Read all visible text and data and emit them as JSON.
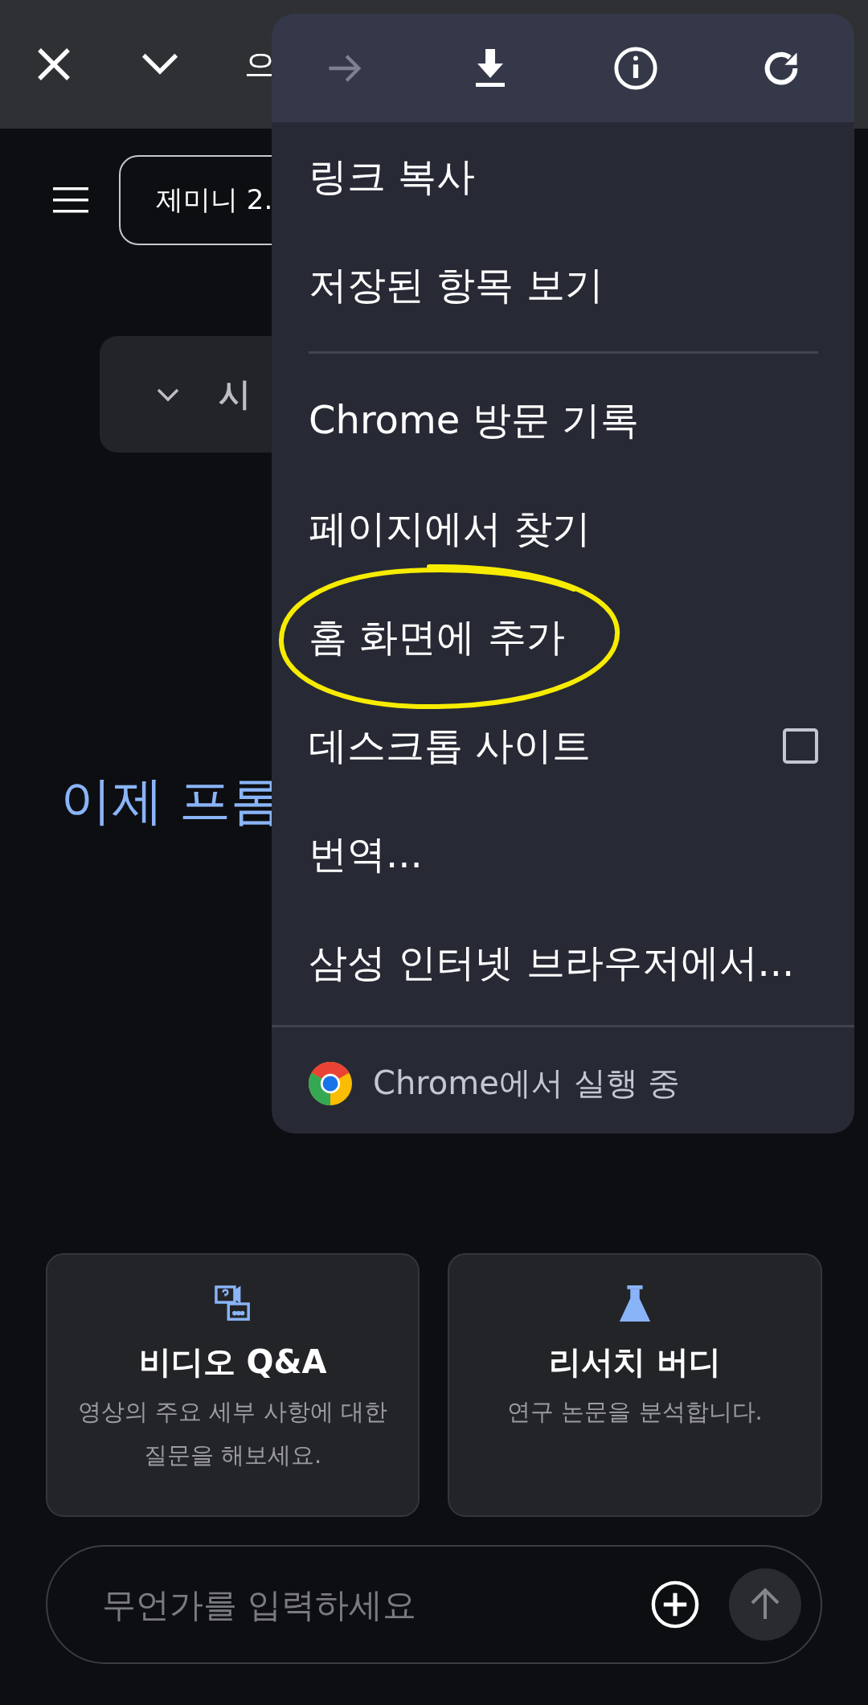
{
  "top_bar": {
    "title": "으"
  },
  "model_button": "제미니 2.",
  "collapsible": "시",
  "heading": "이제 프롬",
  "cards": [
    {
      "kind": "video",
      "title": "비디오 Q&A",
      "description": "영상의 주요 세부 사항에 대한 질문을 해보세요."
    },
    {
      "kind": "research",
      "title": "리서치 버디",
      "description": "연구 논문을 분석합니다."
    }
  ],
  "prompt": {
    "placeholder": "무언가를 입력하세요"
  },
  "menu": {
    "toolbar": [
      {
        "kind": "forward",
        "disabled": true
      },
      {
        "kind": "download",
        "disabled": false
      },
      {
        "kind": "info",
        "disabled": false
      },
      {
        "kind": "reload",
        "disabled": false
      }
    ],
    "items": [
      {
        "kind": "item",
        "label": "링크 복사",
        "highlighted": false
      },
      {
        "kind": "item",
        "label": "저장된 항목 보기",
        "highlighted": false
      },
      {
        "kind": "divider"
      },
      {
        "kind": "item",
        "label": "Chrome 방문 기록",
        "highlighted": false
      },
      {
        "kind": "item",
        "label": "페이지에서 찾기",
        "highlighted": false
      },
      {
        "kind": "item",
        "label": "홈 화면에 추가",
        "highlighted": true
      },
      {
        "kind": "checkbox",
        "label": "데스크톱 사이트",
        "checked": false,
        "highlighted": false
      },
      {
        "kind": "item",
        "label": "번역...",
        "highlighted": false
      },
      {
        "kind": "item",
        "label": "삼성 인터넷 브라우저에서...",
        "highlighted": false
      }
    ],
    "footer": "Chrome에서 실행 중"
  }
}
